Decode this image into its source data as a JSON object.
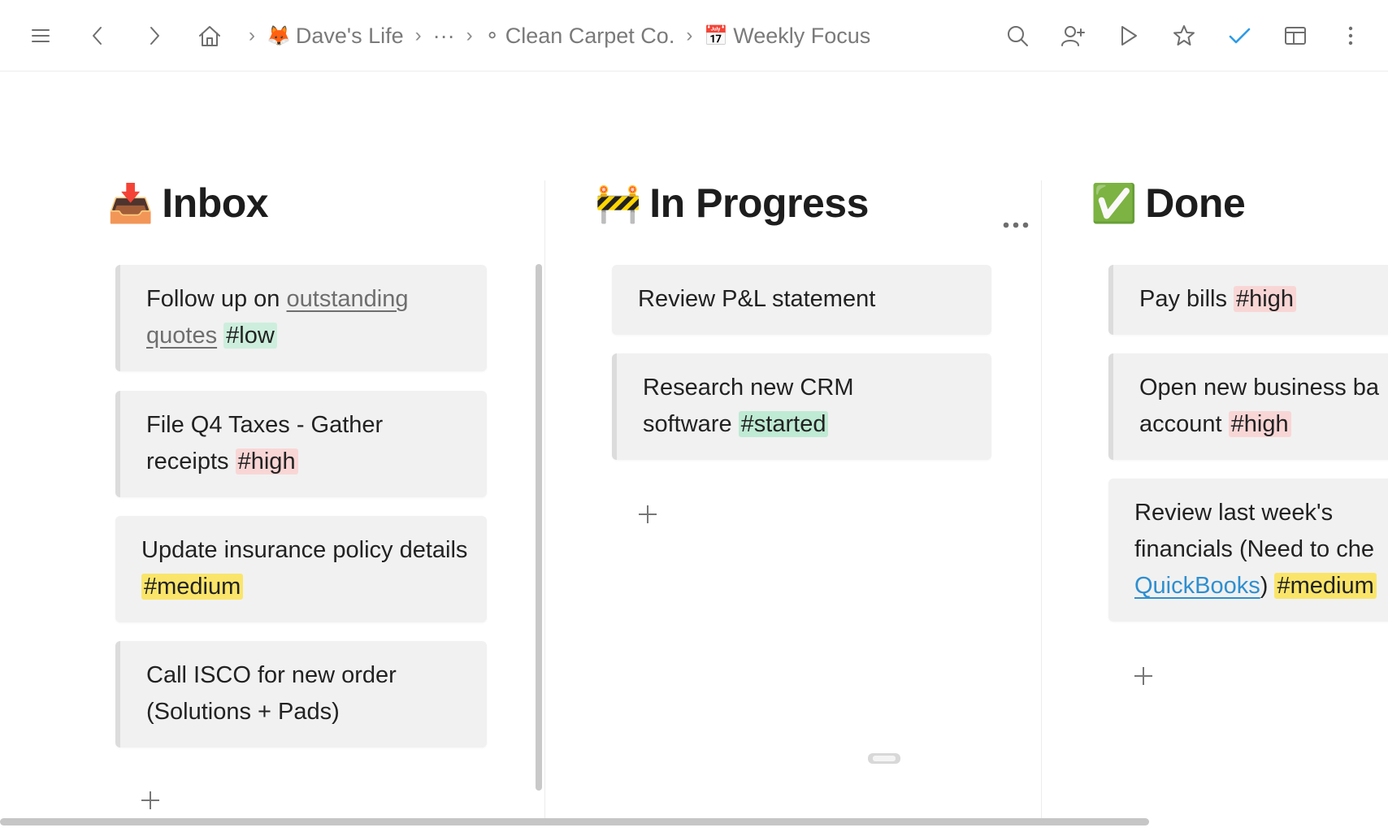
{
  "topbar": {
    "icons": [
      "menu-icon",
      "back-arrow-icon",
      "forward-arrow-icon",
      "home-icon",
      "search-icon",
      "add-user-icon",
      "play-icon",
      "star-icon",
      "check-icon",
      "layout-icon",
      "more-vertical-icon"
    ],
    "breadcrumbs": [
      {
        "emoji": "🦊",
        "label": "Dave's Life"
      },
      {
        "emoji": "",
        "label": "···"
      },
      {
        "emoji": "⚬",
        "label": "Clean Carpet Co."
      },
      {
        "emoji": "📅",
        "label": "Weekly Focus"
      }
    ],
    "separator": "›"
  },
  "columns": {
    "inbox": {
      "emoji": "📥",
      "title": "Inbox",
      "cards": [
        {
          "parts": [
            "Follow up on ",
            "outstanding quotes",
            " ",
            "#low"
          ]
        },
        {
          "parts": [
            "File Q4 Taxes - Gather receipts ",
            "#high"
          ]
        },
        {
          "parts": [
            "Update insurance policy details ",
            "#medium"
          ]
        },
        {
          "parts": [
            "Call ISCO for new order (Solutions + Pads)"
          ]
        }
      ]
    },
    "progress": {
      "emoji": "🚧",
      "title": "In Progress",
      "cards": [
        {
          "parts": [
            "Review P&L statement"
          ]
        },
        {
          "parts": [
            "Research new CRM software ",
            "#started"
          ]
        }
      ]
    },
    "done": {
      "emoji": "✅",
      "title": "Done",
      "cards": [
        {
          "parts": [
            "Pay bills ",
            "#high"
          ]
        },
        {
          "parts": [
            "Open new business ba",
            "account ",
            "#high"
          ]
        },
        {
          "parts": [
            "Review last week's",
            "financials (Need to che",
            "QuickBooks",
            ") ",
            "#medium"
          ]
        }
      ]
    }
  },
  "colors": {
    "tag_low": "#cdeedd",
    "tag_started": "#bfead3",
    "tag_high": "#f9d6d6",
    "tag_medium": "#fae56a",
    "link_blue": "#2e8fd0",
    "check_blue": "#2e9be6"
  }
}
